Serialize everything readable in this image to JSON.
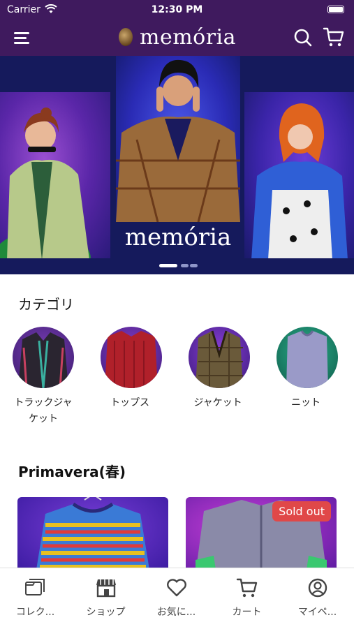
{
  "status_bar": {
    "carrier": "Carrier",
    "time": "12:30 PM"
  },
  "nav": {
    "brand": "memória",
    "icons": [
      "menu-icon",
      "search-icon",
      "cart-icon"
    ]
  },
  "banner": {
    "caption": "memória",
    "slides": 3,
    "active_slide": 1
  },
  "categories": {
    "title": "カテゴリ",
    "items": [
      {
        "label": "トラックジャケット"
      },
      {
        "label": "トップス"
      },
      {
        "label": "ジャケット"
      },
      {
        "label": "ニット"
      }
    ]
  },
  "collection": {
    "title": "Primavera(春)",
    "products": [
      {
        "badge": ""
      },
      {
        "badge": "Sold out"
      }
    ]
  },
  "tabs": [
    {
      "label": "コレク...",
      "icon": "collection-icon"
    },
    {
      "label": "ショップ",
      "icon": "shop-icon"
    },
    {
      "label": "お気に...",
      "icon": "heart-icon"
    },
    {
      "label": "カート",
      "icon": "cart-icon"
    },
    {
      "label": "マイペ...",
      "icon": "account-icon"
    }
  ],
  "colors": {
    "nav_bg": "#3f1a5e",
    "banner_bg": "#151a5c",
    "sold_badge": "#e04848"
  }
}
